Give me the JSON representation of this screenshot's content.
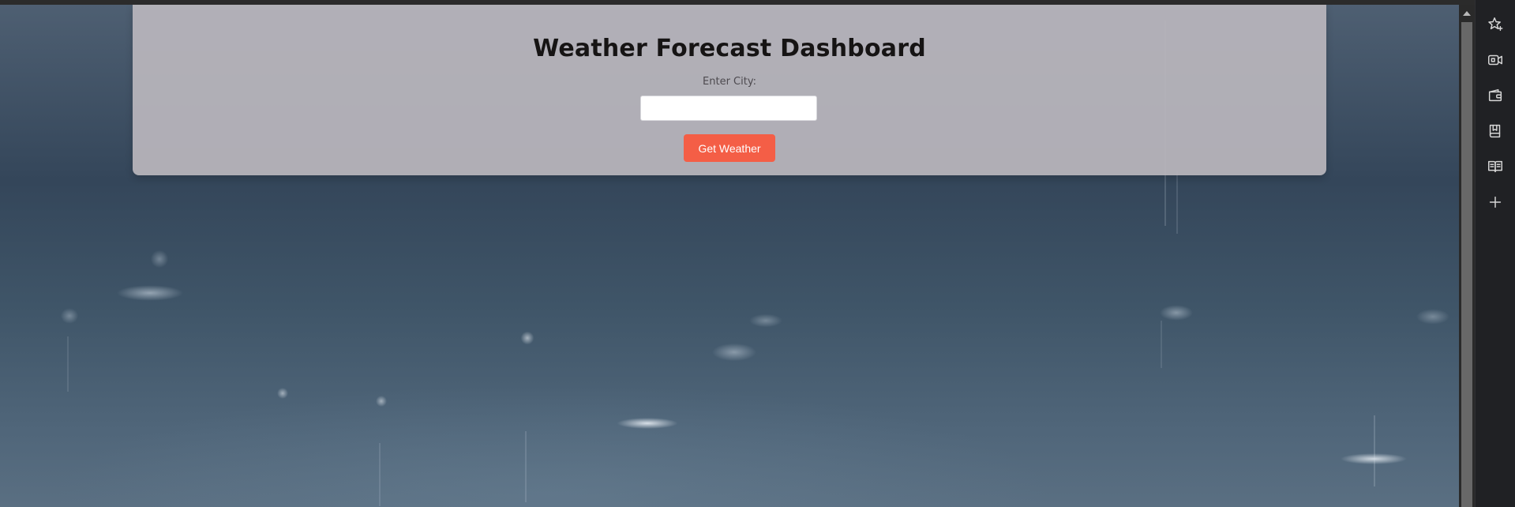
{
  "page": {
    "title": "Weather Forecast Dashboard",
    "city_label": "Enter City:",
    "city_input_value": "",
    "city_input_placeholder": "",
    "button_label": "Get Weather"
  },
  "colors": {
    "button": "#f45e46",
    "panel": "#b9b6bc",
    "title": "#161414",
    "sidebar": "#202124"
  },
  "background": {
    "description_icon": "rainy-sea-background"
  },
  "sidebar": {
    "icons": [
      "sparkle-star-icon",
      "video-camera-icon",
      "wallet-icon",
      "bookmark-book-icon",
      "open-book-icon",
      "plus-icon"
    ]
  }
}
